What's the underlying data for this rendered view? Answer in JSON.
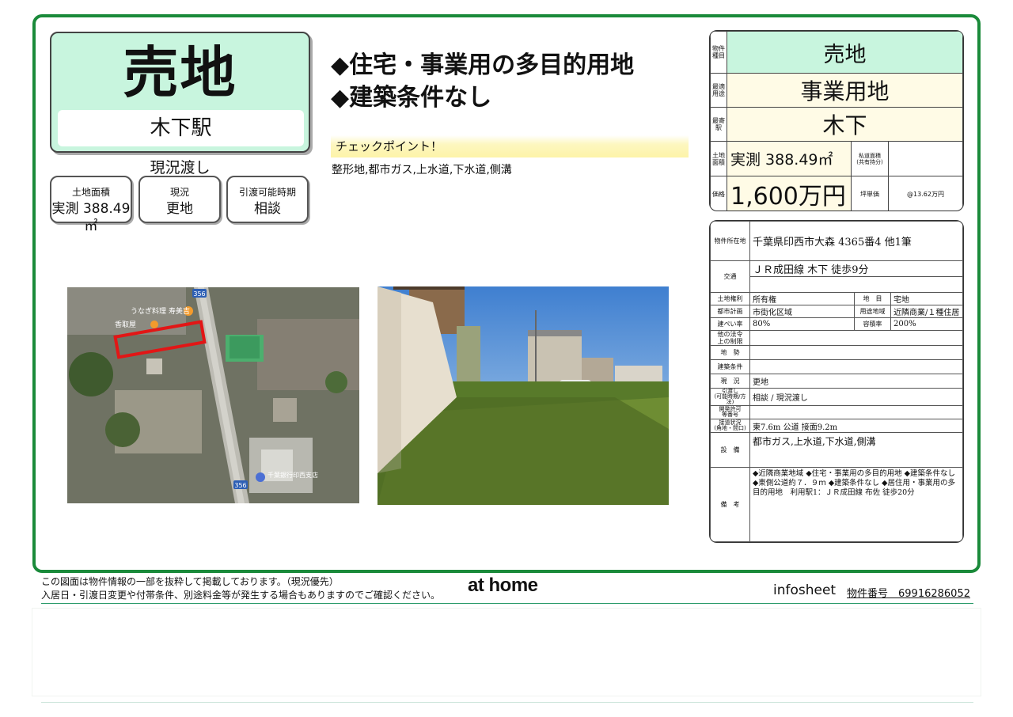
{
  "hero": {
    "title": "売地",
    "station": "木下駅",
    "status": "現況渡し"
  },
  "cards": [
    {
      "label": "土地面積",
      "value": "実測 388.49㎡"
    },
    {
      "label": "現況",
      "value": "更地"
    },
    {
      "label": "引渡可能時期",
      "value": "相談"
    }
  ],
  "headline": {
    "line1": "◆住宅・事業用の多目的用地",
    "line2": "◆建築条件なし"
  },
  "checkpoint": {
    "title": "チェックポイント！",
    "text": "整形地,都市ガス,上水道,下水道,側溝"
  },
  "map": {
    "route_label_top": "356",
    "route_label_bottom": "356",
    "shop_label": "うなぎ料理 寿美吉",
    "place_label": "香取屋",
    "building_label": "千葉銀行印西支店"
  },
  "summary": {
    "type_label": "物件種目",
    "type": "売地",
    "use_label": "最適用途",
    "use": "事業用地",
    "station_label": "最寄駅",
    "station": "木下",
    "area_label": "土地面積",
    "area": "実測 388.49㎡",
    "private_road_label": "私道面積\n(共有持分)",
    "private_road": "",
    "price_label": "価格",
    "price": "1,600万円",
    "tsubo_label": "坪単価",
    "tsubo": "@13.62万円"
  },
  "details": {
    "location_label": "物件所在地",
    "location": "千葉県印西市大森 4365番4 他1筆",
    "traffic_label": "交通",
    "traffic": "ＪＲ成田線 木下 徒歩9分",
    "rows": [
      {
        "k1": "土地権利",
        "v1": "所有権",
        "k2": "地　目",
        "v2": "宅地"
      },
      {
        "k1": "都市計画",
        "v1": "市街化区域",
        "k2": "用途地域",
        "v2": "近隣商業/１種住居"
      },
      {
        "k1": "建ぺい率",
        "v1": "80%",
        "k2": "容積率",
        "v2": "200%"
      }
    ],
    "law_label": "他の法令\n上の制限",
    "law": "",
    "terrain_label": "地　勢",
    "terrain": "",
    "building_label": "建築条件",
    "building": "",
    "current_label": "現　況",
    "current": "更地",
    "handover_label": "引渡し\n(可能時期/方法)",
    "handover": "相談 / 現況渡し",
    "permit_label": "開発許可\n等番号",
    "permit": "",
    "road_label": "接道状況\n(角地・間口)",
    "road": "東7.6m 公道 接面9.2m",
    "facilities_label": "設　備",
    "facilities": "都市ガス,上水道,下水道,側溝",
    "notes_label": "備　考",
    "notes": "◆近隣商業地域 ◆住宅・事業用の多目的用地 ◆建築条件なし ◆東側公道約７．９ｍ ◆建築条件なし ◆居住用・事業用の多目的用地　利用駅1：ＪＲ成田線 布佐 徒歩20分"
  },
  "footer": {
    "note1": "この図面は物件情報の一部を抜粋して掲載しております。（現況優先）",
    "note2": "入居日・引渡日変更や付帯条件、別途料金等が発生する場合もありますのでご確認ください。",
    "logo": "at home",
    "brand": "infosheet",
    "property_no": "物件番号　69916286052"
  },
  "colors": {
    "frame": "#1a8a3a",
    "hero_bg": "#c8f5de",
    "summary_label_bg": "#c8f5de",
    "summary_value_bg": "#fffbe6"
  }
}
